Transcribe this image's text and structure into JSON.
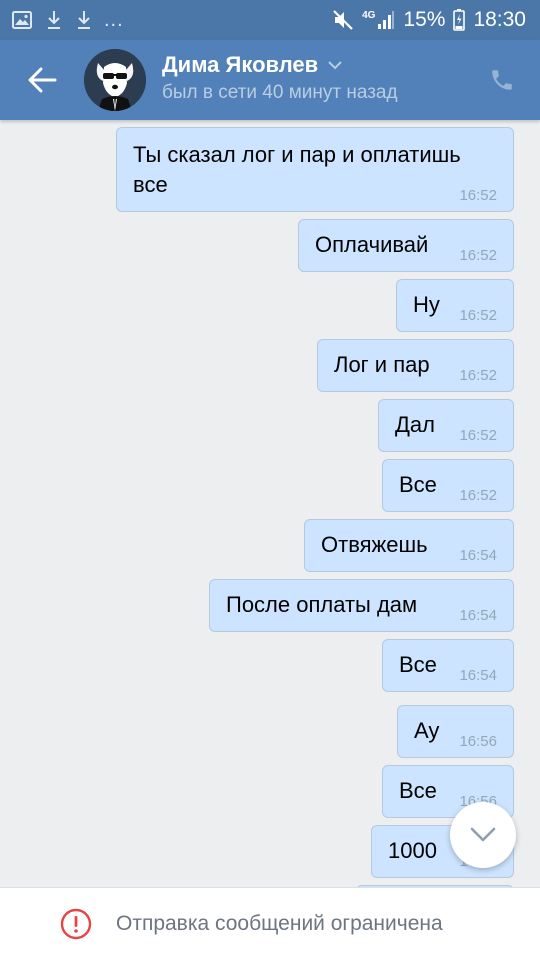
{
  "status_bar": {
    "icons_left": [
      "image-icon",
      "download-icon",
      "download-icon"
    ],
    "more": "...",
    "network": "4G",
    "battery": "15%",
    "time": "18:30"
  },
  "header": {
    "name": "Дима Яковлев",
    "status": "был в сети 40 минут назад",
    "background_color": "#5181b8",
    "statusbar_color": "#4a76a8"
  },
  "messages": [
    {
      "text": "Ты сказал лог и пар и оплатишь все",
      "time": "16:52"
    },
    {
      "text": "Оплачивай",
      "time": "16:52"
    },
    {
      "text": "Ну",
      "time": "16:52"
    },
    {
      "text": "Лог и пар",
      "time": "16:52"
    },
    {
      "text": "Дал",
      "time": "16:52"
    },
    {
      "text": "Все",
      "time": "16:52"
    },
    {
      "text": "Отвяжешь",
      "time": "16:54"
    },
    {
      "text": "После оплаты дам",
      "time": "16:54"
    },
    {
      "text": "Все",
      "time": "16:54"
    },
    {
      "text": "Ау",
      "time": "16:56"
    },
    {
      "text": "Все",
      "time": "16:56"
    },
    {
      "text": "1000",
      "time": "16:56"
    }
  ],
  "bubble_color": "#cce4ff",
  "footer": {
    "restriction_text": "Отправка сообщений ограничена",
    "alert_color": "#e64646"
  }
}
